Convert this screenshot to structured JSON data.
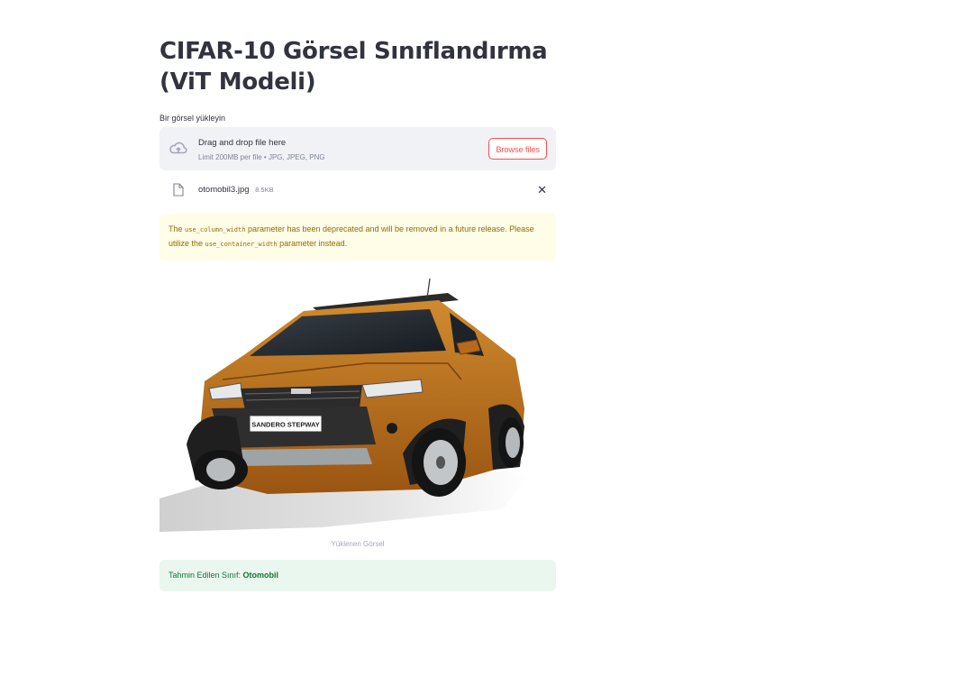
{
  "page": {
    "title": "CIFAR-10 Görsel Sınıflandırma (ViT Modeli)"
  },
  "uploader": {
    "label": "Bir görsel yükleyin",
    "drop_title": "Drag and drop file here",
    "drop_subtitle": "Limit 200MB per file • JPG, JPEG, PNG",
    "browse_label": "Browse files",
    "icon": "cloud-upload-icon"
  },
  "uploaded_file": {
    "name": "otomobil3.jpg",
    "size": "8.5KB",
    "icon": "file-icon",
    "close_glyph": "✕"
  },
  "warning": {
    "text_1": "The ",
    "code_1": "use_column_width",
    "text_2": " parameter has been deprecated and will be removed in a future release. Please utilize the ",
    "code_2": "use_container_width",
    "text_3": " parameter instead."
  },
  "image": {
    "caption": "Yüklenen Görsel",
    "plate_text": "SANDERO STEPWAY"
  },
  "result": {
    "label": "Tahmin Edilen Sınıf: ",
    "value": "Otomobil"
  },
  "colors": {
    "accent": "#ff4b4b",
    "text": "#31333f",
    "warning_bg": "#fffce7",
    "success_bg": "#e9f7ef",
    "car_body": "#b86a1c"
  }
}
